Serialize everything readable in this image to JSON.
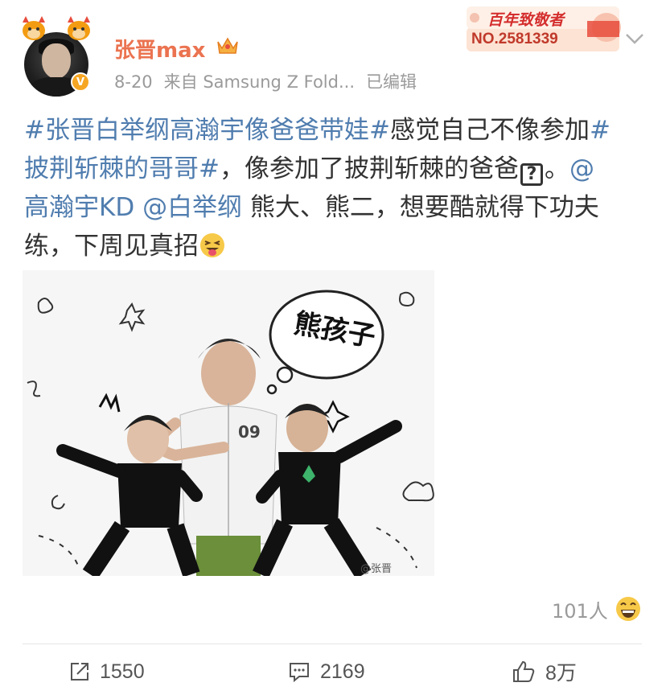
{
  "user": {
    "name": "张晋max",
    "date": "8-20",
    "source": "来自 Samsung Z Fold...",
    "edited": "已编辑"
  },
  "badge": {
    "title": "百年致敬者",
    "number": "NO.2581339"
  },
  "post": {
    "line1_hashtag": "#张晋白举纲高瀚宇像爸爸带娃#",
    "line1_text": "感觉自己不像参加",
    "line1_hashtag2_start": "#",
    "line2_hashtag2_end": "披荆斩棘的哥哥#",
    "line2_text": "，像参加了披荆斩棘的爸爸",
    "line2_qmark": "?",
    "line2_end": "。",
    "line2_mention_at": "@",
    "line3_mention1": "高瀚宇KD",
    "line3_mention2": "@白举纲",
    "line3_text": " 熊大、熊二，想要酷就得下功夫",
    "line4_text": "练，下周见真招"
  },
  "image": {
    "bubble_text": "熊孩子",
    "jersey_number": "09",
    "watermark": "@张晋"
  },
  "reactions": {
    "count": "101人"
  },
  "actions": {
    "repost": "1550",
    "comment": "2169",
    "like": "8万"
  },
  "colors": {
    "link": "#507daf",
    "username": "#eb7350",
    "badge": "#d42e2e"
  }
}
